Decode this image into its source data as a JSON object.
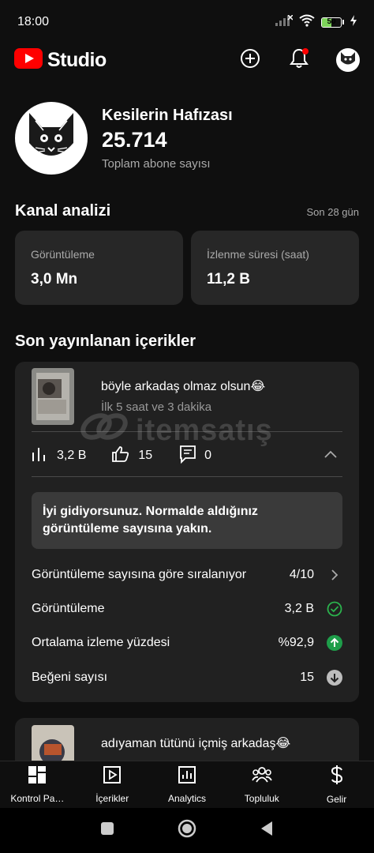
{
  "status_bar": {
    "time": "18:00",
    "battery": "50"
  },
  "app_bar": {
    "logo_text": "Studio"
  },
  "channel": {
    "name": "Kesilerin Hafızası",
    "subscribers": "25.714",
    "subscribers_label": "Toplam abone sayısı"
  },
  "analytics": {
    "title": "Kanal analizi",
    "period": "Son 28 gün",
    "cards": [
      {
        "label": "Görüntüleme",
        "value": "3,0 Mn"
      },
      {
        "label": "İzlenme süresi (saat)",
        "value": "11,2 B"
      }
    ]
  },
  "recent": {
    "title": "Son yayınlanan içerikler",
    "videos": [
      {
        "title": "böyle arkadaş olmaz olsun😂",
        "subtitle": "İlk 5 saat ve 3 dakika",
        "views": "3,2 B",
        "likes": "15",
        "comments": "0",
        "tip": "İyi gidiyorsunuz. Normalde aldığınız görüntüleme sayısına yakın.",
        "details": [
          {
            "label": "Görüntüleme sayısına göre sıralanıyor",
            "value": "4/10",
            "icon": "chevron-right-icon"
          },
          {
            "label": "Görüntüleme",
            "value": "3,2 B",
            "icon": "check-circle-icon"
          },
          {
            "label": "Ortalama izleme yüzdesi",
            "value": "%92,9",
            "icon": "arrow-up-circle-icon"
          },
          {
            "label": "Beğeni sayısı",
            "value": "15",
            "icon": "arrow-down-circle-icon"
          }
        ]
      },
      {
        "title": "adıyaman tütünü içmiş arkadaş😂"
      }
    ]
  },
  "bottom_nav": [
    {
      "label": "Kontrol Pa…",
      "icon": "dashboard-icon"
    },
    {
      "label": "İçerikler",
      "icon": "content-icon"
    },
    {
      "label": "Analytics",
      "icon": "analytics-icon"
    },
    {
      "label": "Topluluk",
      "icon": "community-icon"
    },
    {
      "label": "Gelir",
      "icon": "dollar-icon"
    }
  ],
  "watermark": "itemsatış",
  "colors": {
    "accent": "#ff0000",
    "background": "#0f0f0f",
    "card": "#212121",
    "success": "#1e9e4a"
  }
}
